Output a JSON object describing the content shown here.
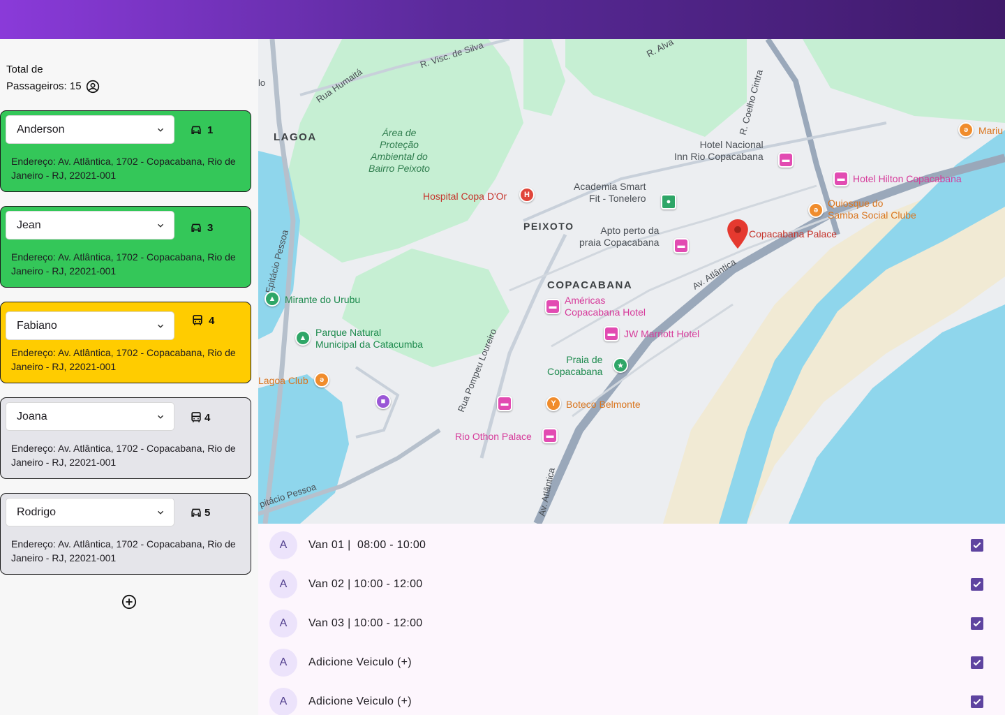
{
  "sidebar": {
    "total_line1": "Total de",
    "total_line2": "Passageiros: 15",
    "add_button_icon": "add-circle-icon",
    "cards": [
      {
        "name": "Anderson",
        "vehicle_icon": "car-icon",
        "count": "1",
        "address": "Endereço: Av. Atlântica, 1702 - Copacabana, Rio de Janeiro - RJ, 22021-001",
        "color": "#34c759"
      },
      {
        "name": "Jean",
        "vehicle_icon": "car-icon",
        "count": "3",
        "address": "Endereço: Av. Atlântica, 1702 - Copacabana, Rio de Janeiro - RJ, 22021-001",
        "color": "#34c759"
      },
      {
        "name": "Fabiano",
        "vehicle_icon": "bus-icon",
        "count": "4",
        "address": "Endereço: Av. Atlântica, 1702 - Copacabana, Rio de Janeiro - RJ, 22021-001",
        "color": "#ffcc00"
      },
      {
        "name": "Joana",
        "vehicle_icon": "bus-icon",
        "count": "4",
        "address": "Endereço: Av. Atlântica, 1702 - Copacabana, Rio de Janeiro - RJ, 22021-001",
        "color": "#e5e5ea"
      },
      {
        "name": "Rodrigo",
        "vehicle_icon": "car-icon",
        "count": "5",
        "address": "Endereço: Av. Atlântica, 1702 - Copacabana, Rio de Janeiro - RJ, 22021-001",
        "color": "#e5e5ea"
      }
    ]
  },
  "map": {
    "labels": {
      "visc_silva": "R. Visc. de Silva",
      "alvaro": "R. Alva",
      "humaita": "Rua Humaitá",
      "coelho_cintra": "R. Coelho Cintra",
      "lagoa": "LAGOA",
      "area_protecao": "Área de\nProteção\nAmbiental do\nBairro Peixoto",
      "hotel_nacional": "Hotel Nacional\nInn Rio Copacabana",
      "mariu": "Mariu",
      "hospital": "Hospital Copa D'Or",
      "academia": "Academia Smart\nFit - Tonelero",
      "hilton": "Hotel Hilton Copacabana",
      "quiosque": "Quiosque do\nSamba Social Clube",
      "peixoto": "PEIXOTO",
      "apto": "Apto perto da\npraia Copacabana",
      "copacabana_palace": "Copacabana Palace",
      "epitacio": "Epitácio Pessoa",
      "av_atlantica_1": "Av. Atlântica",
      "copacabana": "COPACABANA",
      "mirante": "Mirante do Urubu",
      "americas": "Américas\nCopacabana Hotel",
      "parque": "Parque Natural\nMunicipal da Catacumba",
      "jw": "JW Marriott Hotel",
      "praia": "Praia de\nCopacabana",
      "lagoa_club": "Lagoa Club",
      "pompeu": "Rua Pompeu Loureiro",
      "boteco": "Boteco Belmonte",
      "rio_othon": "Rio Othon Palace",
      "epitacio2": "pitácio Pessoa",
      "av_atlantica_2": "Av. Atlântica",
      "lo": "lo"
    }
  },
  "list": {
    "items": [
      {
        "avatar": "A",
        "label": "Van 01 |  08:00 - 10:00",
        "checked": true
      },
      {
        "avatar": "A",
        "label": "Van 02 | 10:00 - 12:00",
        "checked": true
      },
      {
        "avatar": "A",
        "label": "Van 03 | 10:00 - 12:00",
        "checked": true
      },
      {
        "avatar": "A",
        "label": "Adicione Veiculo (+)",
        "checked": true
      },
      {
        "avatar": "A",
        "label": "Adicione Veiculo (+)",
        "checked": true
      }
    ]
  },
  "colors": {
    "topbar_start": "#8a3ad9",
    "topbar_end": "#3f1a6a",
    "checkbox": "#5e44a0",
    "avatar_bg": "#ece3fb"
  }
}
